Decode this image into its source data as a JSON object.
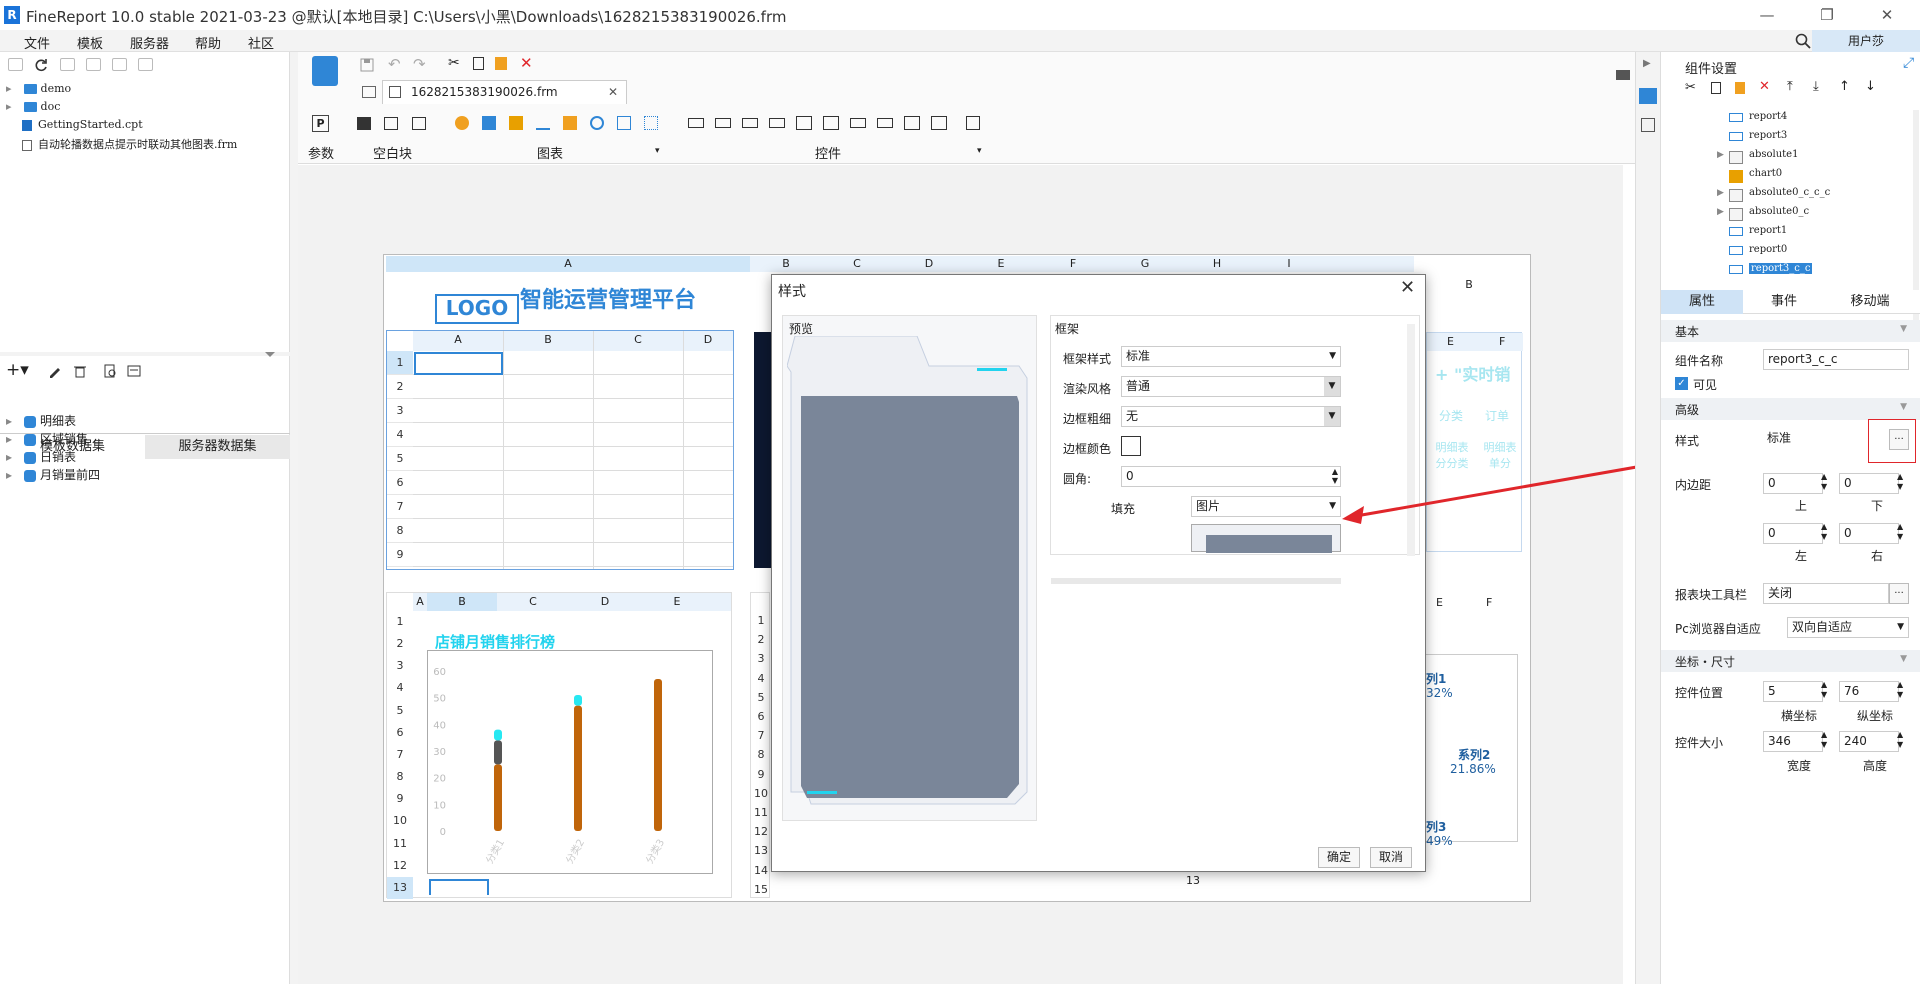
{
  "titlebar": {
    "logo": "R",
    "title": "FineReport 10.0 stable 2021-03-23 @默认[本地目录]    C:\\Users\\小黑\\Downloads\\1628215383190026.frm",
    "min": "—",
    "max": "❐",
    "close": "✕"
  },
  "menu": [
    "文件",
    "模板",
    "服务器",
    "帮助",
    "社区"
  ],
  "user_button": "用户莎",
  "file_tree": [
    {
      "name": "demo",
      "type": "folder"
    },
    {
      "name": "doc",
      "type": "folder"
    },
    {
      "name": "GettingStarted.cpt",
      "type": "file"
    },
    {
      "name": "自动轮播数据点提示时联动其他图表.frm",
      "type": "file"
    }
  ],
  "dataset_tabs": [
    "模板数据集",
    "服务器数据集"
  ],
  "datasets": [
    "明细表",
    "区域销售",
    "日销表",
    "月销量前四"
  ],
  "file_tab": "1628215383190026.frm",
  "toolbar_groups": {
    "param": "参数",
    "blank": "空白块",
    "chart": "图表",
    "widget": "控件"
  },
  "canvas": {
    "logo_text": "LOGO",
    "platform_title": "智能运营管理平台",
    "top_cols": [
      "A",
      "B",
      "C",
      "D",
      "E",
      "F",
      "G",
      "H",
      "I"
    ],
    "left_cols": [
      "A",
      "B",
      "C",
      "D"
    ],
    "left_rows": [
      "1",
      "2",
      "3",
      "4",
      "5",
      "6",
      "7",
      "8",
      "9"
    ],
    "chart_title": "店铺月销售排行榜",
    "bottom_cols": [
      "A",
      "B",
      "C",
      "D",
      "E"
    ],
    "bottom_rows": [
      "1",
      "2",
      "3",
      "4",
      "5",
      "6",
      "7",
      "8",
      "9",
      "10",
      "11",
      "12",
      "13"
    ],
    "mid_rows": [
      "1",
      "2",
      "3",
      "4",
      "5",
      "6",
      "7",
      "8",
      "9",
      "10",
      "11",
      "12",
      "13",
      "14",
      "15"
    ],
    "right_cols": [
      "E",
      "F"
    ],
    "right_top_cols": [
      "B"
    ],
    "realtime_title": "+ \"实时销",
    "realtime_cols": [
      "分类",
      "订单"
    ],
    "realtime_cells": [
      "明细表\n分分类",
      "明细表\n单分"
    ],
    "series_labels": [
      {
        "name": "列1",
        "pct": "32%"
      },
      {
        "name": "系列2",
        "pct": "21.86%"
      },
      {
        "name": "列3",
        "pct": "49%"
      }
    ],
    "row13": "13"
  },
  "chart_data": {
    "type": "bar",
    "title": "店铺月销售排行榜",
    "categories": [
      "分类1",
      "分类2",
      "分类3"
    ],
    "ylim": [
      0,
      60
    ],
    "yticks": [
      "0",
      "10",
      "20",
      "30",
      "40",
      "50",
      "60"
    ],
    "series": [
      {
        "values": [
          25,
          47,
          57
        ]
      },
      {
        "values": [
          9,
          0,
          0
        ]
      },
      {
        "values": [
          4,
          4,
          0
        ]
      }
    ],
    "colors": [
      "#c0650a",
      "#555555",
      "#27e8f2"
    ]
  },
  "dialog": {
    "title": "样式",
    "preview_label": "预览",
    "frame_label": "框架",
    "frame_style_label": "框架样式",
    "frame_style_value": "标准",
    "render_label": "渲染风格",
    "render_value": "普通",
    "border_label": "边框粗细",
    "border_value": "无",
    "border_color_label": "边框颜色",
    "radius_label": "圆角:",
    "radius_value": "0",
    "fill_label": "填充",
    "fill_value": "图片",
    "ok": "确定",
    "cancel": "取消"
  },
  "right_panel": {
    "title": "组件设置",
    "tree": [
      {
        "name": "report4",
        "type": "report"
      },
      {
        "name": "report3",
        "type": "report"
      },
      {
        "name": "absolute1",
        "type": "abs"
      },
      {
        "name": "chart0",
        "type": "chart"
      },
      {
        "name": "absolute0_c_c_c",
        "type": "abs"
      },
      {
        "name": "absolute0_c",
        "type": "abs"
      },
      {
        "name": "report1",
        "type": "report"
      },
      {
        "name": "report0",
        "type": "report"
      },
      {
        "name": "report3_c_c",
        "type": "report",
        "selected": true
      }
    ],
    "tabs": [
      "属性",
      "事件",
      "移动端"
    ],
    "basic": "基本",
    "name_label": "组件名称",
    "name_value": "report3_c_c",
    "visible_label": "可见",
    "advanced": "高级",
    "style_label": "样式",
    "style_value": "标准",
    "padding_label": "内边距",
    "padding": {
      "top": "0",
      "bottom": "0",
      "left": "0",
      "right": "0"
    },
    "padding_names": {
      "top": "上",
      "bottom": "下",
      "left": "左",
      "right": "右"
    },
    "toolbar_label": "报表块工具栏",
    "toolbar_value": "关闭",
    "adapt_label": "Pc浏览器自适应",
    "adapt_value": "双向自适应",
    "coord_section": "坐标・尺寸",
    "pos_label": "控件位置",
    "pos_x": "5",
    "pos_y": "76",
    "x_name": "横坐标",
    "y_name": "纵坐标",
    "size_label": "控件大小",
    "width": "346",
    "height": "240",
    "w_name": "宽度",
    "h_name": "高度"
  },
  "colors": {
    "accent": "#1a73d9",
    "arrow": "#e0262b",
    "frame": "#7a8699",
    "cyan": "#22d3ee"
  }
}
